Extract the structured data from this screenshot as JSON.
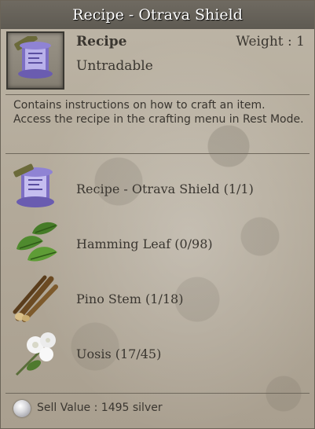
{
  "title": "Recipe - Otrava Shield",
  "header": {
    "category": "Recipe",
    "weight": "Weight : 1",
    "tradability": "Untradable"
  },
  "description": "Contains instructions on how to craft an item. Access the recipe in the crafting menu in Rest Mode.",
  "materials": [
    {
      "icon": "recipe-scroll-icon",
      "label": "Recipe - Otrava Shield (1/1)"
    },
    {
      "icon": "hamming-leaf-icon",
      "label": "Hamming Leaf (0/98)"
    },
    {
      "icon": "pino-stem-icon",
      "label": "Pino Stem (1/18)"
    },
    {
      "icon": "uosis-flower-icon",
      "label": "Uosis (17/45)"
    }
  ],
  "footer": {
    "coin_icon": "silver-coin-icon",
    "sell_value": "Sell Value : 1495 silver"
  }
}
